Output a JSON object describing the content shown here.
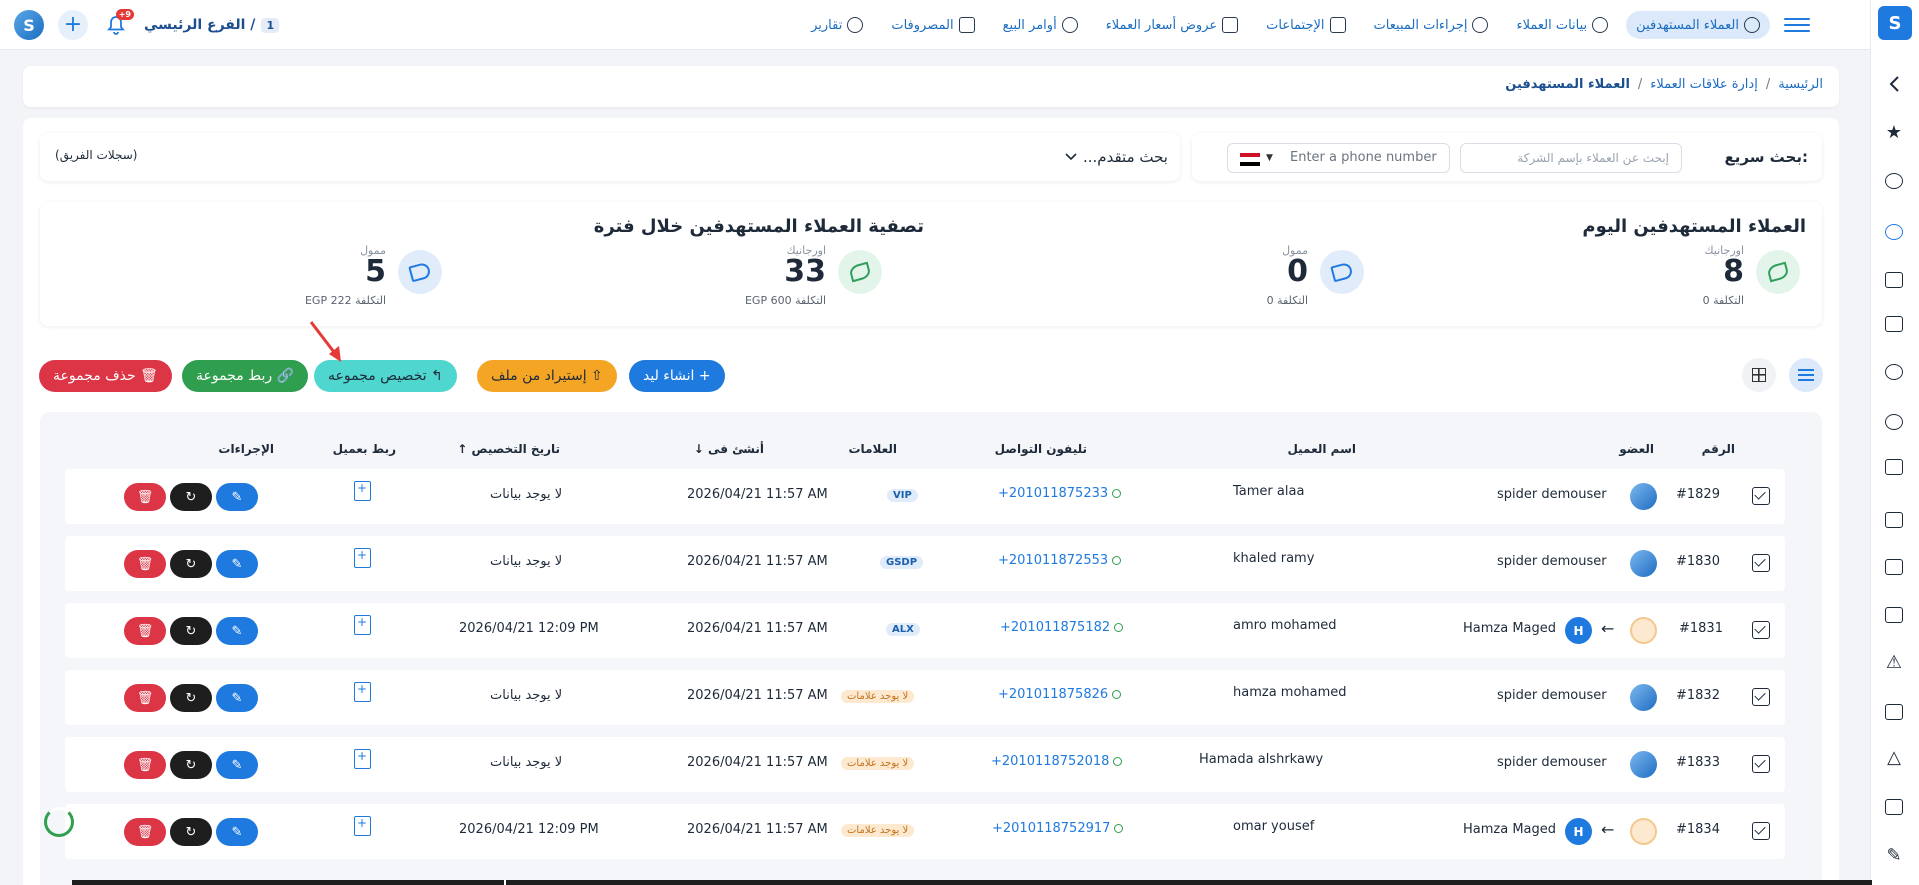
{
  "topbar": {
    "branch_label": "الفرع الرئيسي /",
    "branch_number": "1",
    "notification_count": "+9",
    "nav": [
      {
        "label": "العملاء المستهدفين",
        "icon": "targeted-customers-icon"
      },
      {
        "label": "بيانات العملاء",
        "icon": "customer-data-icon"
      },
      {
        "label": "إجراءات المبيعات",
        "icon": "phone-icon"
      },
      {
        "label": "الإجتماعات",
        "icon": "meetings-icon"
      },
      {
        "label": "عروض أسعار العملاء",
        "icon": "quotations-icon"
      },
      {
        "label": "أوامر البيع",
        "icon": "sales-orders-icon"
      },
      {
        "label": "المصروفات",
        "icon": "expenses-icon"
      },
      {
        "label": "تقارير",
        "icon": "reports-icon"
      }
    ]
  },
  "breadcrumb": {
    "home": "الرئيسية",
    "section": "إدارة علاقات العملاء",
    "current": "العملاء المستهدفين"
  },
  "search": {
    "quick_label": "بحث سريع:",
    "company_placeholder": "إبحث عن العملاء بإسم الشركة",
    "phone_placeholder": "Enter a phone number",
    "advanced_label": "بحث متقدم...",
    "team_records": "(سجلات الفريق)"
  },
  "stats": {
    "today_title": "العملاء المستهدفين اليوم",
    "period_title": "تصفية العملاء المستهدفين خلال فترة",
    "today": [
      {
        "kind": "اورجانيك",
        "value": "8",
        "cost": "التكلفة 0"
      },
      {
        "kind": "ممول",
        "value": "0",
        "cost": "التكلفة 0"
      }
    ],
    "period": [
      {
        "kind": "اورجانيك",
        "value": "33",
        "cost": "التكلفة 600 EGP"
      },
      {
        "kind": "ممول",
        "value": "5",
        "cost": "التكلفة 222 EGP"
      }
    ]
  },
  "actions": {
    "create_lead": "+ انشاء ليد",
    "import_file": "⇧ إستيراد من ملف",
    "assign_group": "↰ تخصيص مجموعه",
    "link_group": "🔗 ربط مجموعة",
    "delete_group": "🗑 حذف مجموعة"
  },
  "table": {
    "headers": {
      "number": "الرقم",
      "member": "العضو",
      "customer_name": "اسم العميل",
      "phone": "تليفون التواصل",
      "tags": "العلامات",
      "created_at": "أنشئ فى",
      "assigned_at": "تاريخ التخصيص",
      "link_customer": "ربط بعميل",
      "actions": "الإجراءات"
    },
    "rows": [
      {
        "id": "#1829",
        "member": "spider demouser",
        "assigned_to": "",
        "name": "Tamer alaa",
        "phone": "+201011875233",
        "tag": "VIP",
        "tag_type": "code",
        "created": "2026/04/21 11:57 AM",
        "assigned": "لا يوجد بيانات"
      },
      {
        "id": "#1830",
        "member": "spider demouser",
        "assigned_to": "",
        "name": "khaled ramy",
        "phone": "+201011872553",
        "tag": "GSDP",
        "tag_type": "code",
        "created": "2026/04/21 11:57 AM",
        "assigned": "لا يوجد بيانات"
      },
      {
        "id": "#1831",
        "member": "",
        "assigned_to": "Hamza Maged",
        "name": "amro mohamed",
        "phone": "+201011875182",
        "tag": "ALX",
        "tag_type": "code",
        "created": "2026/04/21 11:57 AM",
        "assigned": "2026/04/21 12:09 PM"
      },
      {
        "id": "#1832",
        "member": "spider demouser",
        "assigned_to": "",
        "name": "hamza mohamed",
        "phone": "+201011875826",
        "tag": "لا يوجد علامات",
        "tag_type": "none",
        "created": "2026/04/21 11:57 AM",
        "assigned": "لا يوجد بيانات"
      },
      {
        "id": "#1833",
        "member": "spider demouser",
        "assigned_to": "",
        "name": "Hamada alshrkawy",
        "phone": "+2010118752018",
        "tag": "لا يوجد علامات",
        "tag_type": "none",
        "created": "2026/04/21 11:57 AM",
        "assigned": "لا يوجد بيانات"
      },
      {
        "id": "#1834",
        "member": "",
        "assigned_to": "Hamza Maged",
        "name": "omar yousef",
        "phone": "+2010118752917",
        "tag": "لا يوجد علامات",
        "tag_type": "none",
        "created": "2026/04/21 11:57 AM",
        "assigned": "2026/04/21 12:09 PM"
      }
    ]
  },
  "colors": {
    "primary": "#1f7ae0",
    "success": "#2f9e4f",
    "danger": "#dc3545",
    "warning": "#f5a524",
    "cyan": "#4fd6cf"
  }
}
